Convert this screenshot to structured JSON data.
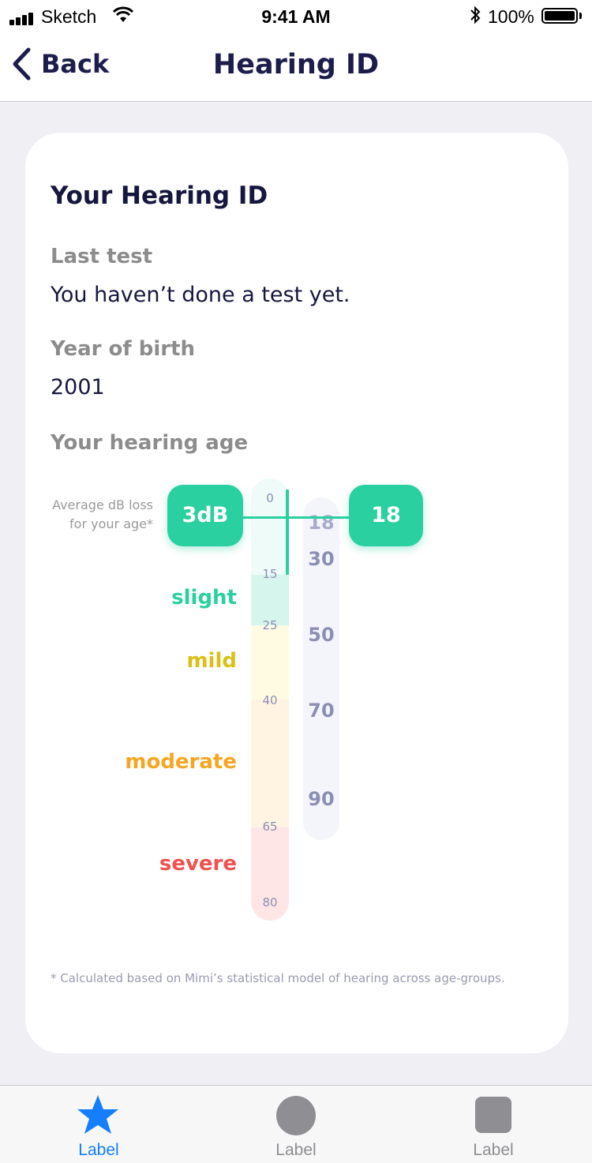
{
  "status": {
    "carrier": "Sketch",
    "time": "9:41 AM",
    "battery_pct": "100%"
  },
  "nav": {
    "back_label": "Back",
    "title": "Hearing ID"
  },
  "card": {
    "heading": "Your Hearing ID",
    "last_test_label": "Last test",
    "last_test_value": "You haven’t done a test yet.",
    "birth_label": "Year of birth",
    "birth_value": "2001",
    "hearing_age_label": "Your hearing age",
    "avg_label_line1": "Average dB loss",
    "avg_label_line2": "for your age*",
    "db_badge": "3dB",
    "age_badge": "18",
    "footnote": "* Calculated based on Mimi’s statistical model of hearing across age-groups."
  },
  "scale": {
    "db_ticks": [
      "0",
      "15",
      "25",
      "40",
      "65",
      "80"
    ],
    "age_ticks": [
      "18",
      "30",
      "50",
      "70",
      "90"
    ],
    "categories": [
      {
        "label": "slight",
        "color": "#2bd0a0"
      },
      {
        "label": "mild",
        "color": "#d9c118"
      },
      {
        "label": "moderate",
        "color": "#f5a623"
      },
      {
        "label": "severe",
        "color": "#ef5350"
      }
    ],
    "band_colors": {
      "normal": "#eefbf8",
      "slight": "#d6f5ec",
      "mild": "#fffbe3",
      "moderate": "#fff3e2",
      "severe": "#ffe6e6"
    }
  },
  "tabs": [
    {
      "label": "Label",
      "icon": "star-icon",
      "active": true
    },
    {
      "label": "Label",
      "icon": "circle-icon",
      "active": false
    },
    {
      "label": "Label",
      "icon": "square-icon",
      "active": false
    }
  ],
  "colors": {
    "accent": "#2bd0a0",
    "tab_active": "#147efb",
    "tab_inactive": "#8e8e93"
  }
}
